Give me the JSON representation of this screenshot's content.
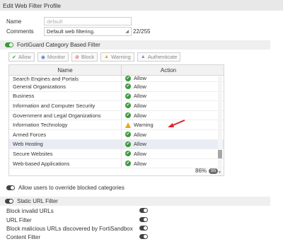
{
  "header": {
    "title": "Edit Web Filter Profile"
  },
  "form": {
    "name_label": "Name",
    "name_placeholder": "default",
    "comments_label": "Comments",
    "comments_value": "Default web filtering.",
    "comments_count": "22/255"
  },
  "fortiguard": {
    "title": "FortiGuard Category Based Filter",
    "buttons": [
      {
        "label": "Allow",
        "icon": "check-icon"
      },
      {
        "label": "Monitor",
        "icon": "eye-icon"
      },
      {
        "label": "Block",
        "icon": "block-icon"
      },
      {
        "label": "Warning",
        "icon": "warning-icon"
      },
      {
        "label": "Authenticate",
        "icon": "user-icon"
      }
    ],
    "columns": {
      "name": "Name",
      "action": "Action"
    },
    "rows": [
      {
        "name": "Search Engines and Portals",
        "action": "Allow"
      },
      {
        "name": "General Organizations",
        "action": "Allow"
      },
      {
        "name": "Business",
        "action": "Allow"
      },
      {
        "name": "Information and Computer Security",
        "action": "Allow"
      },
      {
        "name": "Government and Legal Organizations",
        "action": "Allow"
      },
      {
        "name": "Information Technology",
        "action": "Warning"
      },
      {
        "name": "Armed Forces",
        "action": "Allow"
      },
      {
        "name": "Web Hosting",
        "action": "Allow"
      },
      {
        "name": "Secure Websites",
        "action": "Allow"
      },
      {
        "name": "Web-based Applications",
        "action": "Allow"
      }
    ],
    "percent": "86%",
    "count_badge": "95",
    "colors": {
      "allow": "#3c9a3c",
      "warning": "#e6a817",
      "arrow": "#d9262b"
    }
  },
  "override": {
    "label": "Allow users to override blocked categories"
  },
  "static": {
    "title": "Static URL Filter",
    "options": [
      {
        "label": "Block invalid URLs"
      },
      {
        "label": "URL Filter"
      },
      {
        "label": "Block malicious URLs discovered by FortiSandbox"
      },
      {
        "label": "Content Filter"
      }
    ]
  }
}
